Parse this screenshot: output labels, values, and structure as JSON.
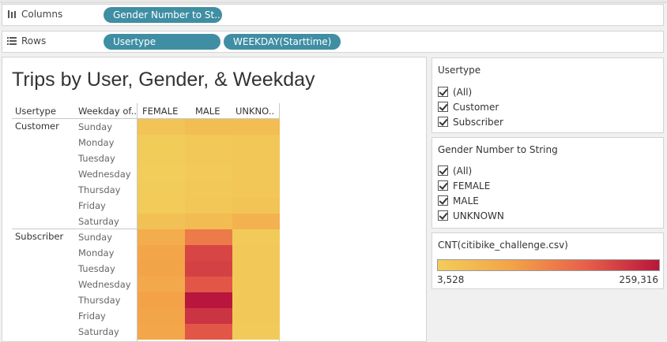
{
  "shelves": {
    "columns": {
      "label": "Columns",
      "pills": [
        "Gender Number to St.."
      ]
    },
    "rows": {
      "label": "Rows",
      "pills": [
        "Usertype",
        "WEEKDAY(Starttime)"
      ]
    }
  },
  "view": {
    "title": "Trips by User, Gender, & Weekday",
    "header": {
      "usertype": "Usertype",
      "weekday": "Weekday of..",
      "genders": [
        "FEMALE",
        "MALE",
        "UNKNO.."
      ]
    },
    "groups": [
      {
        "name": "Customer",
        "days": [
          "Sunday",
          "Monday",
          "Tuesday",
          "Wednesday",
          "Thursday",
          "Friday",
          "Saturday"
        ]
      },
      {
        "name": "Subscriber",
        "days": [
          "Sunday",
          "Monday",
          "Tuesday",
          "Wednesday",
          "Thursday",
          "Friday",
          "Saturday"
        ]
      }
    ]
  },
  "chart_data": {
    "type": "heatmap",
    "title": "Trips by User, Gender, & Weekday",
    "x_categories": [
      "FEMALE",
      "MALE",
      "UNKNO.."
    ],
    "row_groups": [
      "Customer",
      "Subscriber"
    ],
    "y_categories": [
      "Sunday",
      "Monday",
      "Tuesday",
      "Wednesday",
      "Thursday",
      "Friday",
      "Saturday"
    ],
    "color_range": [
      3528,
      259316
    ],
    "color_stops": [
      "#f2cd5a",
      "#f3a348",
      "#e8604a",
      "#b8163c"
    ],
    "values": {
      "Customer": [
        [
          24000,
          34000,
          36000
        ],
        [
          6000,
          12000,
          18000
        ],
        [
          5000,
          11000,
          16000
        ],
        [
          4500,
          10500,
          15000
        ],
        [
          5500,
          13000,
          18000
        ],
        [
          7500,
          15000,
          22000
        ],
        [
          28000,
          38000,
          58000
        ]
      ],
      "Subscriber": [
        [
          68000,
          140000,
          10000
        ],
        [
          82000,
          205000,
          11000
        ],
        [
          86000,
          210000,
          11500
        ],
        [
          76000,
          185000,
          11000
        ],
        [
          90000,
          259316,
          12000
        ],
        [
          84000,
          225000,
          11000
        ],
        [
          80000,
          185000,
          9500
        ]
      ]
    }
  },
  "filters": [
    {
      "title": "Usertype",
      "options": [
        "(All)",
        "Customer",
        "Subscriber"
      ]
    },
    {
      "title": "Gender Number to String",
      "options": [
        "(All)",
        "FEMALE",
        "MALE",
        "UNKNOWN"
      ]
    }
  ],
  "legend": {
    "title": "CNT(citibike_challenge.csv)",
    "min_label": "3,528",
    "max_label": "259,316"
  }
}
